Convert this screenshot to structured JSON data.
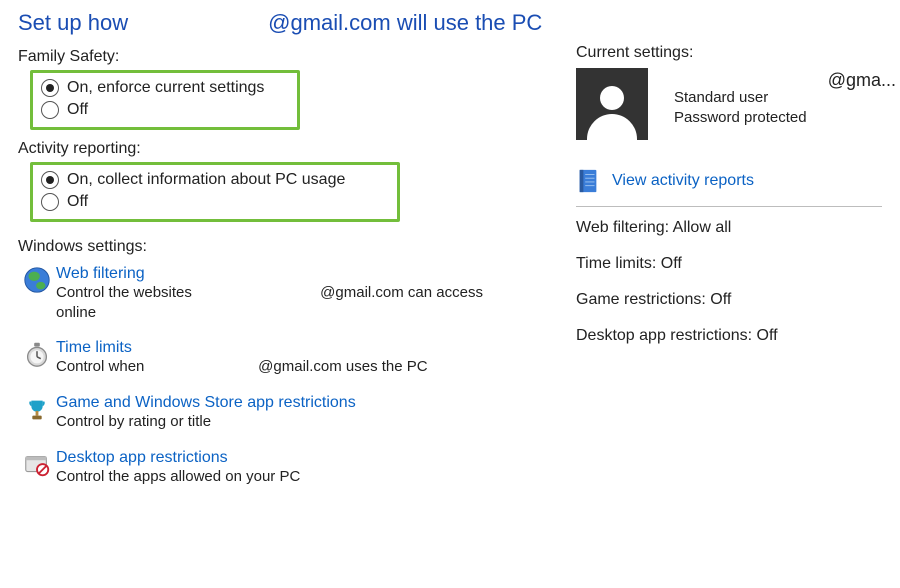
{
  "title": {
    "part1": "Set up how",
    "part2": "@gmail.com will use the PC"
  },
  "family_safety": {
    "label": "Family Safety:",
    "options": [
      {
        "label": "On, enforce current settings",
        "selected": true
      },
      {
        "label": "Off",
        "selected": false
      }
    ]
  },
  "activity_reporting": {
    "label": "Activity reporting:",
    "options": [
      {
        "label": "On, collect information about PC usage",
        "selected": true
      },
      {
        "label": "Off",
        "selected": false
      }
    ]
  },
  "windows_settings": {
    "heading": "Windows settings:",
    "items": {
      "web_filtering": {
        "title": "Web filtering",
        "desc_left": "Control the websites",
        "desc_right": "@gmail.com can access",
        "desc_line2": "online"
      },
      "time_limits": {
        "title": "Time limits",
        "desc_left": "Control when",
        "desc_right": "@gmail.com uses the PC"
      },
      "game_restrictions": {
        "title": "Game and Windows Store app restrictions",
        "desc": "Control by rating or title"
      },
      "desktop_restrictions": {
        "title": "Desktop app restrictions",
        "desc": "Control the apps allowed on your PC"
      }
    }
  },
  "right": {
    "heading": "Current settings:",
    "user_email": "@gma...",
    "role": "Standard user",
    "password": "Password protected",
    "activity_link": "View activity reports",
    "stats": {
      "web_filtering": {
        "label": "Web filtering:",
        "value": "Allow all"
      },
      "time_limits": {
        "label": "Time limits:",
        "value": "Off"
      },
      "game_restrictions": {
        "label": "Game restrictions:",
        "value": "Off"
      },
      "desktop_restrictions": {
        "label": "Desktop app restrictions:",
        "value": "Off"
      }
    }
  }
}
